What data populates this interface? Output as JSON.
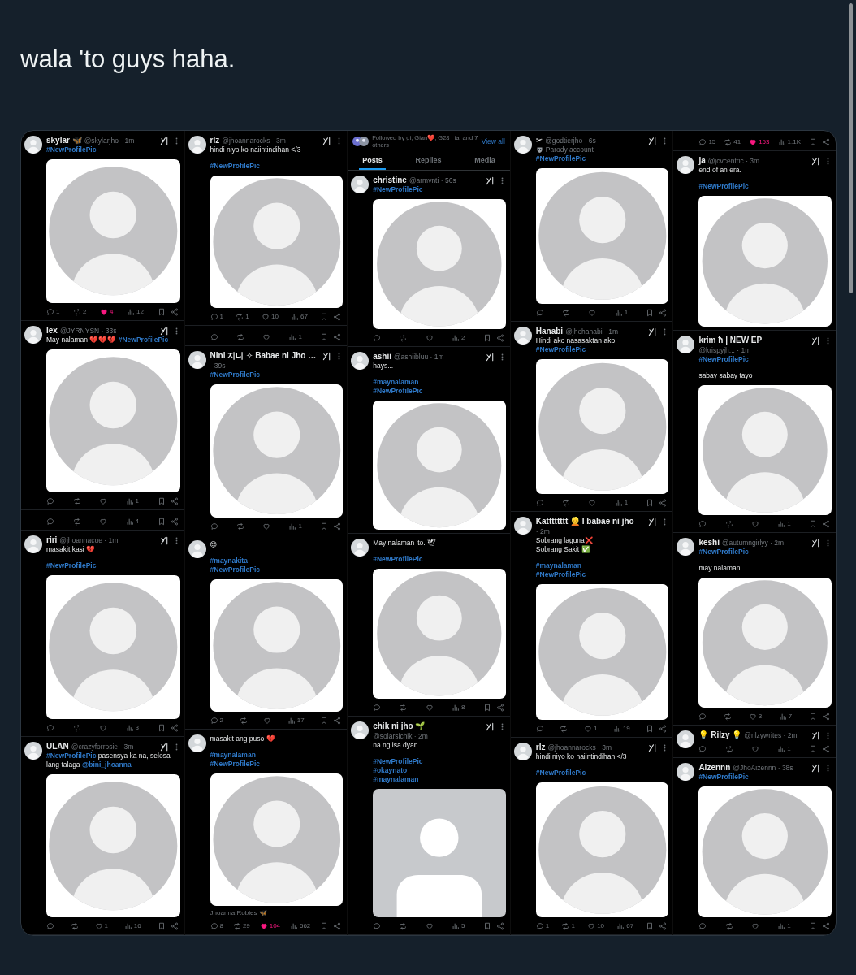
{
  "post": {
    "text": "wala 'to guys haha."
  },
  "collage": {
    "columns": [
      {
        "items": [
          {
            "kind": "tweet",
            "name": "skylar 🦋",
            "meta": "@skylarjho · 1m",
            "body": [
              {
                "lines": [
                  {
                    "segs": [
                      {
                        "kind": "hashtag",
                        "text": "#NewProfilePic"
                      }
                    ]
                  }
                ]
              }
            ],
            "picture": {
              "kind": "round"
            },
            "actions": {
              "reply": "1",
              "repost": "2",
              "like": "4",
              "liked": true,
              "views": "12"
            }
          },
          {
            "kind": "tweet",
            "name": "lex",
            "meta": "@JYRNYSN · 33s",
            "body": [
              {
                "lines": [
                  {
                    "segs": [
                      {
                        "kind": "text",
                        "text": "May nalaman 💔💔💔 "
                      },
                      {
                        "kind": "hashtag",
                        "text": "#NewProfilePic"
                      }
                    ]
                  }
                ]
              }
            ],
            "picture": {
              "kind": "round"
            },
            "actions": {
              "liked": false,
              "views": "1"
            }
          },
          {
            "kind": "actions",
            "actions": {
              "liked": false,
              "views": "4"
            }
          },
          {
            "kind": "tweet",
            "name": "riri",
            "meta": "@jhoannacue · 1m",
            "body": [
              {
                "lines": [
                  {
                    "segs": [
                      {
                        "kind": "text",
                        "text": "masakit kasi 💔"
                      }
                    ]
                  }
                ]
              },
              {
                "lines": [
                  {
                    "segs": [
                      {
                        "kind": "hashtag",
                        "text": "#NewProfilePic"
                      }
                    ]
                  }
                ]
              }
            ],
            "picture": {
              "kind": "round"
            },
            "actions": {
              "liked": false,
              "views": "3"
            }
          },
          {
            "kind": "tweet",
            "name": "ULAN",
            "meta": "@crazyforrosie · 3m",
            "body": [
              {
                "lines": [
                  {
                    "segs": [
                      {
                        "kind": "hashtag",
                        "text": "#NewProfilePic"
                      },
                      {
                        "kind": "text",
                        "text": " pasensya ka na, selosa lang talaga "
                      },
                      {
                        "kind": "mention",
                        "text": "@bini_jhoanna"
                      }
                    ]
                  }
                ]
              }
            ],
            "picture": {
              "kind": "round"
            },
            "actions": {
              "like": "1",
              "liked": false,
              "views": "16"
            }
          }
        ]
      },
      {
        "items": [
          {
            "kind": "tweet",
            "name": "rlz",
            "meta": "@jhoannarocks · 3m",
            "body": [
              {
                "lines": [
                  {
                    "segs": [
                      {
                        "kind": "text",
                        "text": "hindi niyo ko naiintindihan </3"
                      }
                    ]
                  }
                ]
              },
              {
                "lines": [
                  {
                    "segs": [
                      {
                        "kind": "hashtag",
                        "text": "#NewProfilePic"
                      }
                    ]
                  }
                ]
              }
            ],
            "picture": {
              "kind": "round"
            },
            "actions": {
              "reply": "1",
              "repost": "1",
              "like": "10",
              "liked": false,
              "views": "67"
            }
          },
          {
            "kind": "actions",
            "actions": {
              "liked": false,
              "views": "1"
            }
          },
          {
            "kind": "tweet",
            "name": "Nini 지니 ✧ Babae ni Jho …",
            "meta": "· 39s",
            "body": [
              {
                "lines": [
                  {
                    "segs": [
                      {
                        "kind": "hashtag",
                        "text": "#NewProfilePic"
                      }
                    ]
                  }
                ]
              }
            ],
            "picture": {
              "kind": "round"
            },
            "actions": {
              "liked": false,
              "views": "1"
            }
          },
          {
            "kind": "tweet",
            "body": [
              {
                "lines": [
                  {
                    "segs": [
                      {
                        "kind": "text",
                        "text": "😊"
                      }
                    ]
                  }
                ]
              },
              {
                "lines": [
                  {
                    "segs": [
                      {
                        "kind": "hashtag",
                        "text": "#maynakita"
                      }
                    ]
                  },
                  {
                    "segs": [
                      {
                        "kind": "hashtag",
                        "text": "#NewProfilePic"
                      }
                    ]
                  }
                ]
              }
            ],
            "picture": {
              "kind": "round"
            },
            "actions": {
              "reply": "2",
              "liked": false,
              "views": "17"
            }
          },
          {
            "kind": "tweet",
            "body": [
              {
                "lines": [
                  {
                    "segs": [
                      {
                        "kind": "text",
                        "text": "masakit ang puso 💔"
                      }
                    ]
                  }
                ]
              },
              {
                "lines": [
                  {
                    "segs": [
                      {
                        "kind": "hashtag",
                        "text": "#maynalaman"
                      }
                    ]
                  },
                  {
                    "segs": [
                      {
                        "kind": "hashtag",
                        "text": "#NewProfilePic"
                      }
                    ]
                  }
                ]
              }
            ],
            "picture": {
              "kind": "round"
            },
            "caption": "Jhoanna Robles 🦋",
            "actions": {
              "reply": "8",
              "repost": "29",
              "like": "104",
              "liked": true,
              "views": "562"
            }
          }
        ]
      },
      {
        "items": [
          {
            "kind": "profile",
            "followed_by": "Followed by gi, Gian❤️, G28 | ia, and 7 others",
            "view_all": "View all",
            "tabs": [
              {
                "label": "Posts",
                "selected": true
              },
              {
                "label": "Replies",
                "selected": false
              },
              {
                "label": "Media",
                "selected": false
              }
            ]
          },
          {
            "kind": "tweet",
            "name": "christine",
            "meta": "@armvnti · 56s",
            "body": [
              {
                "lines": [
                  {
                    "segs": [
                      {
                        "kind": "hashtag",
                        "text": "#NewProfilePic"
                      }
                    ]
                  }
                ]
              }
            ],
            "picture": {
              "kind": "round"
            },
            "actions": {
              "liked": false,
              "views": "2"
            }
          },
          {
            "kind": "tweet",
            "name": "ashii",
            "meta": "@ashiibluu · 1m",
            "body": [
              {
                "lines": [
                  {
                    "segs": [
                      {
                        "kind": "text",
                        "text": "hays..."
                      }
                    ]
                  }
                ]
              },
              {
                "lines": [
                  {
                    "segs": [
                      {
                        "kind": "hashtag",
                        "text": "#maynalaman"
                      }
                    ]
                  },
                  {
                    "segs": [
                      {
                        "kind": "hashtag",
                        "text": "#NewProfilePic"
                      }
                    ]
                  }
                ]
              }
            ],
            "picture": {
              "kind": "round"
            }
          },
          {
            "kind": "tweet",
            "body": [
              {
                "lines": [
                  {
                    "segs": [
                      {
                        "kind": "text",
                        "text": "May nalaman 'to. 🕊"
                      }
                    ]
                  }
                ]
              },
              {
                "lines": [
                  {
                    "segs": [
                      {
                        "kind": "hashtag",
                        "text": "#NewProfilePic"
                      }
                    ]
                  }
                ]
              }
            ],
            "picture": {
              "kind": "round"
            },
            "actions": {
              "liked": false,
              "views": "8"
            }
          },
          {
            "kind": "tweet",
            "name": "chik ni jho 🌱",
            "meta": "@solarsichik · 2m",
            "body": [
              {
                "lines": [
                  {
                    "segs": [
                      {
                        "kind": "text",
                        "text": "na ng isa dyan"
                      }
                    ]
                  }
                ]
              },
              {
                "lines": [
                  {
                    "segs": [
                      {
                        "kind": "hashtag",
                        "text": "#NewProfilePic"
                      }
                    ]
                  },
                  {
                    "segs": [
                      {
                        "kind": "hashtag",
                        "text": "#okaynato"
                      }
                    ]
                  },
                  {
                    "segs": [
                      {
                        "kind": "hashtag",
                        "text": "#maynalaman"
                      }
                    ]
                  }
                ]
              }
            ],
            "picture": {
              "kind": "flat"
            },
            "actions": {
              "liked": false,
              "views": "5"
            }
          }
        ]
      },
      {
        "items": [
          {
            "kind": "tweet",
            "name": "✂",
            "meta": "@godtierjho · 6s",
            "label": "Parody account",
            "body": [
              {
                "lines": [
                  {
                    "segs": [
                      {
                        "kind": "hashtag",
                        "text": "#NewProfilePic"
                      }
                    ]
                  }
                ]
              }
            ],
            "picture": {
              "kind": "round"
            },
            "actions": {
              "liked": false,
              "views": "1"
            }
          },
          {
            "kind": "tweet",
            "name": "Hanabi",
            "meta": "@jhohanabi · 1m",
            "body": [
              {
                "lines": [
                  {
                    "segs": [
                      {
                        "kind": "text",
                        "text": "Hindi ako nasasaktan ako"
                      }
                    ]
                  },
                  {
                    "segs": [
                      {
                        "kind": "hashtag",
                        "text": "#NewProfilePic"
                      }
                    ]
                  }
                ]
              }
            ],
            "picture": {
              "kind": "round"
            },
            "actions": {
              "liked": false,
              "views": "1"
            }
          },
          {
            "kind": "tweet",
            "name": "Katttttttt 👱 I babae ni jho",
            "meta": "· 2m",
            "body": [
              {
                "lines": [
                  {
                    "segs": [
                      {
                        "kind": "text",
                        "text": "Sobrang laguna❌"
                      }
                    ]
                  },
                  {
                    "segs": [
                      {
                        "kind": "text",
                        "text": "Sobrang Sakit ✅"
                      }
                    ]
                  }
                ]
              },
              {
                "lines": [
                  {
                    "segs": [
                      {
                        "kind": "hashtag",
                        "text": "#maynalaman"
                      }
                    ]
                  },
                  {
                    "segs": [
                      {
                        "kind": "hashtag",
                        "text": "#NewProfilePic"
                      }
                    ]
                  }
                ]
              }
            ],
            "picture": {
              "kind": "round"
            },
            "actions": {
              "like": "1",
              "liked": false,
              "views": "19"
            }
          },
          {
            "kind": "tweet",
            "name": "rlz",
            "meta": "@jhoannarocks · 3m",
            "body": [
              {
                "lines": [
                  {
                    "segs": [
                      {
                        "kind": "text",
                        "text": "hindi niyo ko naiintindihan </3"
                      }
                    ]
                  }
                ]
              },
              {
                "lines": [
                  {
                    "segs": [
                      {
                        "kind": "hashtag",
                        "text": "#NewProfilePic"
                      }
                    ]
                  }
                ]
              }
            ],
            "picture": {
              "kind": "round"
            },
            "actions": {
              "reply": "1",
              "repost": "1",
              "like": "10",
              "liked": false,
              "views": "67"
            }
          }
        ]
      },
      {
        "items": [
          {
            "kind": "actions",
            "actions": {
              "reply": "15",
              "repost": "41",
              "like": "153",
              "liked": true,
              "views": "1.1K"
            }
          },
          {
            "kind": "tweet",
            "name": "ja",
            "meta": "@jcvcentric · 3m",
            "body": [
              {
                "lines": [
                  {
                    "segs": [
                      {
                        "kind": "text",
                        "text": "end of an era."
                      }
                    ]
                  }
                ]
              },
              {
                "lines": [
                  {
                    "segs": [
                      {
                        "kind": "hashtag",
                        "text": "#NewProfilePic"
                      }
                    ]
                  }
                ]
              }
            ],
            "picture": {
              "kind": "round"
            }
          },
          {
            "kind": "tweet",
            "name": "krim ħ | NEW EP",
            "meta": "@krispyjh... · 1m",
            "body": [
              {
                "lines": [
                  {
                    "segs": [
                      {
                        "kind": "hashtag",
                        "text": "#NewProfilePic"
                      }
                    ]
                  }
                ]
              },
              {
                "lines": [
                  {
                    "segs": [
                      {
                        "kind": "text",
                        "text": "sabay sabay tayo"
                      }
                    ]
                  }
                ]
              }
            ],
            "picture": {
              "kind": "round"
            },
            "actions": {
              "liked": false,
              "views": "1"
            }
          },
          {
            "kind": "tweet",
            "name": "keshi",
            "meta": "@autumngirlyy · 2m",
            "body": [
              {
                "lines": [
                  {
                    "segs": [
                      {
                        "kind": "hashtag",
                        "text": "#NewProfilePic"
                      }
                    ]
                  }
                ]
              },
              {
                "lines": [
                  {
                    "segs": [
                      {
                        "kind": "text",
                        "text": "may nalaman"
                      }
                    ]
                  }
                ]
              }
            ],
            "picture": {
              "kind": "round"
            },
            "actions": {
              "like": "3",
              "liked": false,
              "views": "7"
            }
          },
          {
            "kind": "tweet",
            "name": "💡 Rilzy 💡",
            "meta": "@rilzywrites · 2m",
            "actions": {
              "liked": false,
              "views": "1"
            }
          },
          {
            "kind": "tweet",
            "name": "Aizennn",
            "meta": "@JhoAizennn · 38s",
            "body": [
              {
                "lines": [
                  {
                    "segs": [
                      {
                        "kind": "hashtag",
                        "text": "#NewProfilePic"
                      }
                    ]
                  }
                ]
              }
            ],
            "picture": {
              "kind": "round"
            },
            "actions": {
              "liked": false,
              "views": "1"
            }
          }
        ]
      }
    ]
  }
}
